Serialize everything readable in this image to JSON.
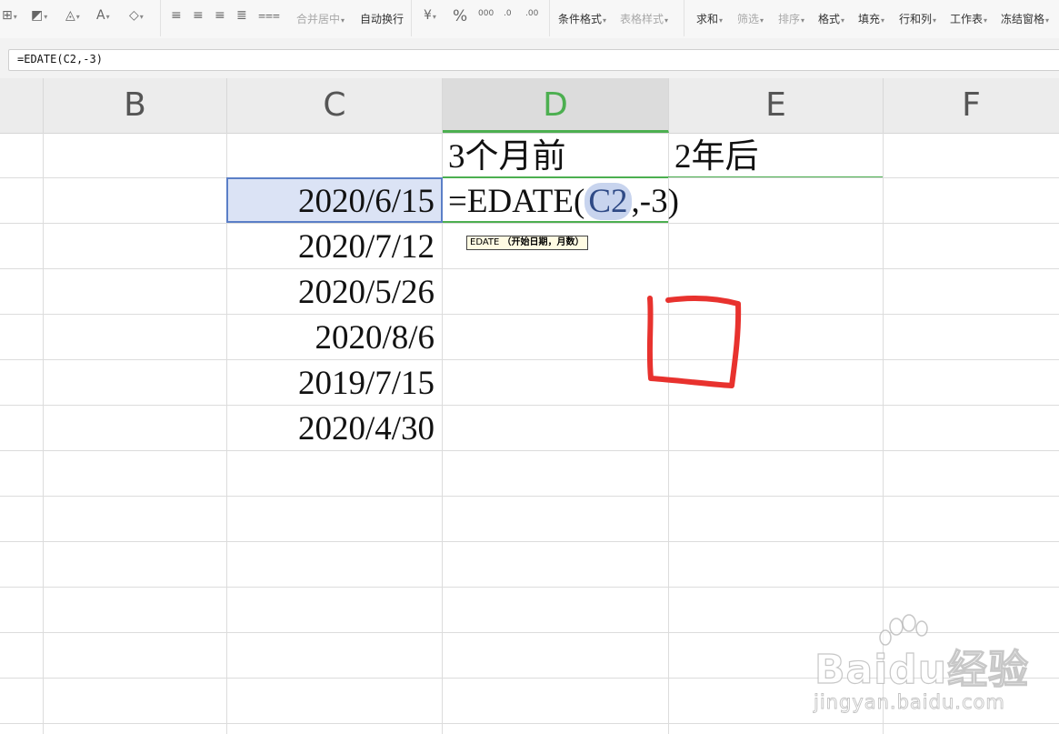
{
  "ribbon": {
    "merge_center": "合并居中",
    "wrap_text": "自动换行",
    "percent": "%",
    "cond_format": "条件格式",
    "table_style": "表格样式",
    "sum": "求和",
    "filter": "筛选",
    "sort": "排序",
    "format": "格式",
    "fill": "填充",
    "row_col": "行和列",
    "worksheet": "工作表",
    "freeze": "冻结窗格"
  },
  "formula_bar": {
    "value": "=EDATE(C2,-3)"
  },
  "columns": [
    "B",
    "C",
    "D",
    "E",
    "F"
  ],
  "cells": {
    "D1": "3个月前",
    "E1": "2年后",
    "C": [
      "2020/6/15",
      "2020/7/12",
      "2020/5/26",
      "2020/8/6",
      "2019/7/15",
      "2020/4/30"
    ]
  },
  "editing": {
    "prefix": "=EDATE(",
    "ref": "C2",
    "suffix": ",-3)",
    "tooltip_fn": "EDATE",
    "tooltip_args": "（开始日期，月数）"
  },
  "watermark": {
    "brand": "Baidu经验",
    "url": "jingyan.baidu.com"
  },
  "colors": {
    "accent_green": "#4caf50",
    "annotation_red": "#e8322e",
    "selection_blue": "#5b7fc7"
  }
}
